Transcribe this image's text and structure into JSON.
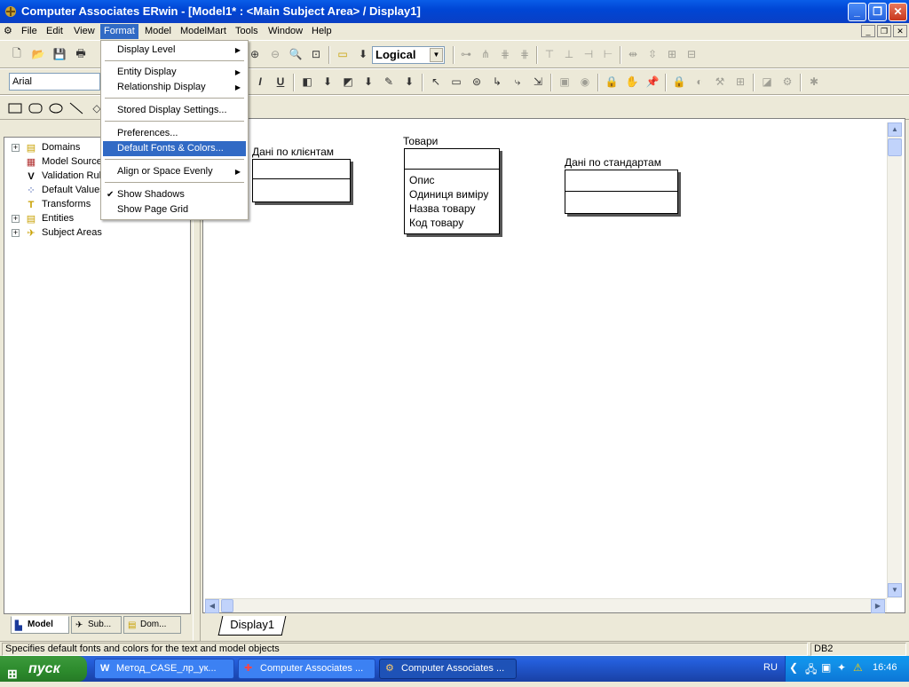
{
  "window": {
    "title": "Computer Associates ERwin - [Model1* : <Main Subject Area> / Display1]"
  },
  "menubar": {
    "items": [
      "File",
      "Edit",
      "View",
      "Format",
      "Model",
      "ModelMart",
      "Tools",
      "Window",
      "Help"
    ],
    "active": "Format"
  },
  "format_menu": {
    "items": [
      {
        "label": "Display Level",
        "submenu": true
      },
      {
        "label": "Entity Display",
        "submenu": true
      },
      {
        "label": "Relationship Display",
        "submenu": true
      },
      {
        "label": "Stored Display Settings..."
      },
      {
        "label": "Preferences..."
      },
      {
        "label": "Default Fonts & Colors...",
        "highlighted": true
      },
      {
        "label": "Align or Space Evenly",
        "submenu": true
      },
      {
        "label": "Show Shadows",
        "checked": true
      },
      {
        "label": "Show Page Grid"
      }
    ]
  },
  "toolbar": {
    "level_combo": "Logical",
    "font_combo": "Arial",
    "italic_label": "I",
    "underline_label": "U"
  },
  "model_tree": {
    "items": [
      "Domains",
      "Model Sources",
      "Validation Rules",
      "Default Values",
      "Transforms",
      "Entities",
      "Subject Areas"
    ]
  },
  "panel_tabs": [
    "Model",
    "Sub...",
    "Dom..."
  ],
  "diagram": {
    "entities": [
      {
        "name": "Дані по клієнтам",
        "attributes": []
      },
      {
        "name": "Товари",
        "attributes": [
          "Опис",
          "Одиниця виміру",
          "Назва товару",
          "Код товару"
        ]
      },
      {
        "name": "Дані по стандартам",
        "attributes": []
      }
    ],
    "tab": "Display1"
  },
  "statusbar": {
    "message": "Specifies default fonts and colors for the text and model objects",
    "db": "DB2"
  },
  "taskbar": {
    "start": "пуск",
    "tasks": [
      "Метод_CASE_лр_ук...",
      "Computer Associates ...",
      "Computer Associates ..."
    ],
    "lang": "RU",
    "clock": "16:46"
  },
  "colors": {
    "titlebar": "#0a5de8",
    "menu_highlight": "#316ac5",
    "taskbar": "#245edb",
    "start": "#2c8a2c"
  }
}
